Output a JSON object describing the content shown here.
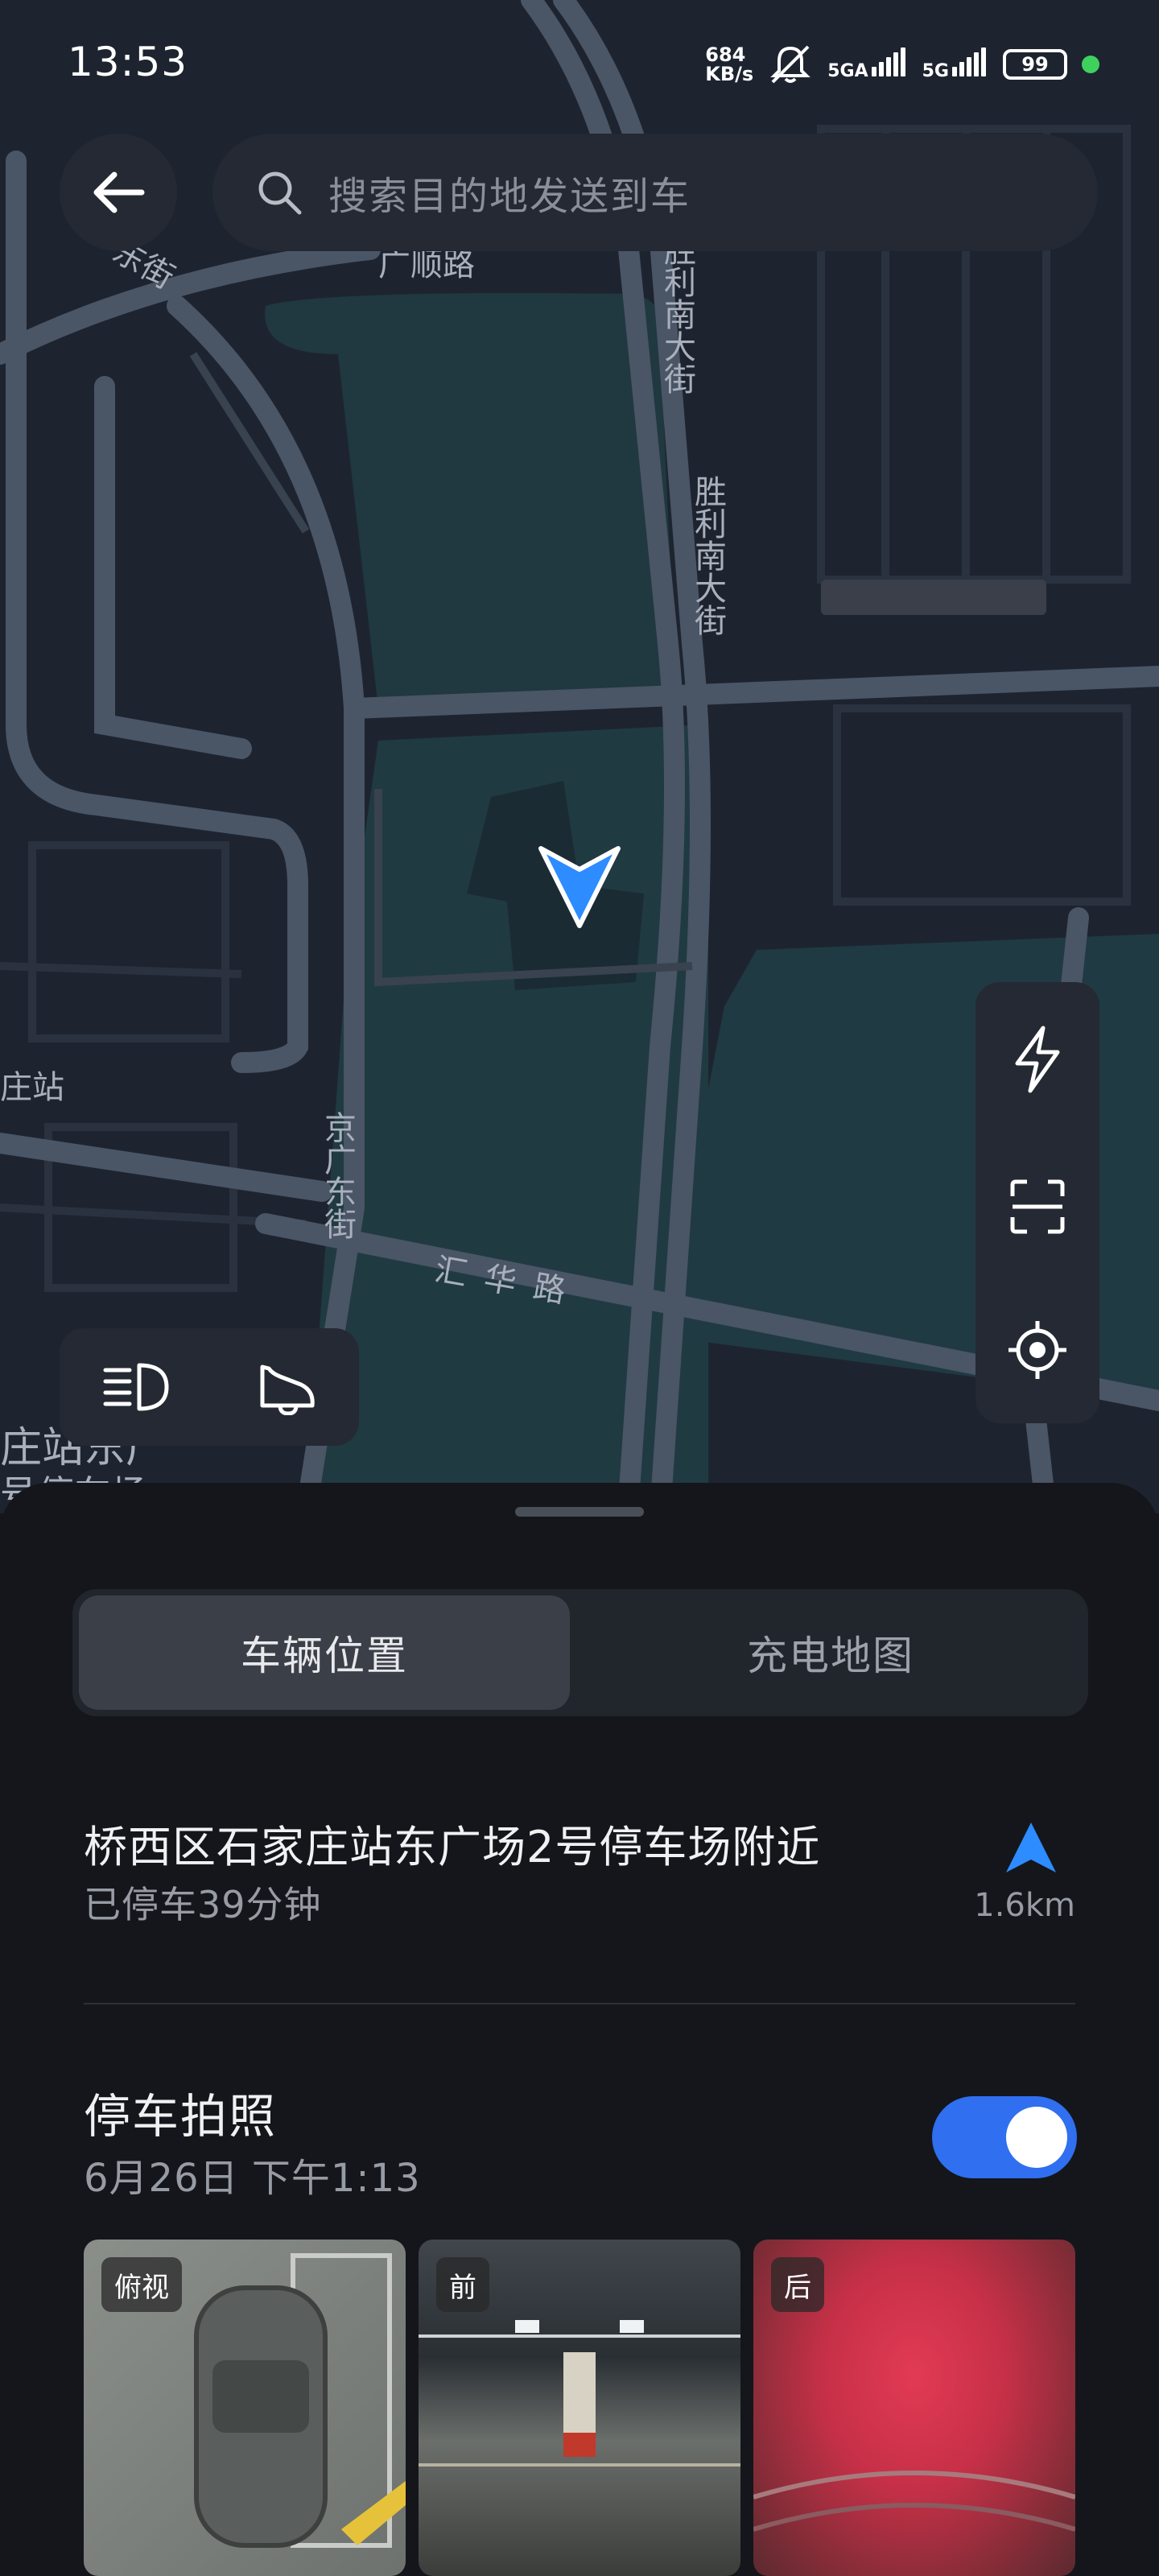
{
  "status_bar": {
    "time": "13:53",
    "net_speed_value": "684",
    "net_speed_unit": "KB/s",
    "sim1": "5GA",
    "sim2": "5G",
    "battery": "99",
    "colors": {
      "dot": "#3fd15e"
    }
  },
  "search": {
    "placeholder": "搜索目的地发送到车"
  },
  "map": {
    "labels": [
      "广顺路",
      "东街",
      "胜利南大街",
      "胜利南大街",
      "京广东街",
      "汇华路",
      "庄站",
      "庄站东广",
      "号停车场"
    ],
    "controls": [
      "lightning-icon",
      "scan-icon",
      "locate-icon"
    ],
    "light_controls": [
      "headlight-icon",
      "horn-icon"
    ]
  },
  "sheet": {
    "tabs": [
      {
        "label": "车辆位置",
        "active": true
      },
      {
        "label": "充电地图",
        "active": false
      }
    ],
    "location": {
      "title": "桥西区石家庄站东广场2号停车场附近",
      "subtitle": "已停车39分钟",
      "distance": "1.6km"
    },
    "parking_photo": {
      "title": "停车拍照",
      "date": "6月26日 下午1:13",
      "toggle_on": true,
      "thumbs": [
        {
          "label": "俯视"
        },
        {
          "label": "前"
        },
        {
          "label": "后"
        }
      ]
    }
  },
  "colors": {
    "accent": "#2f6ff0",
    "arrow": "#2d8cff",
    "sheet_bg": "#14161b"
  }
}
